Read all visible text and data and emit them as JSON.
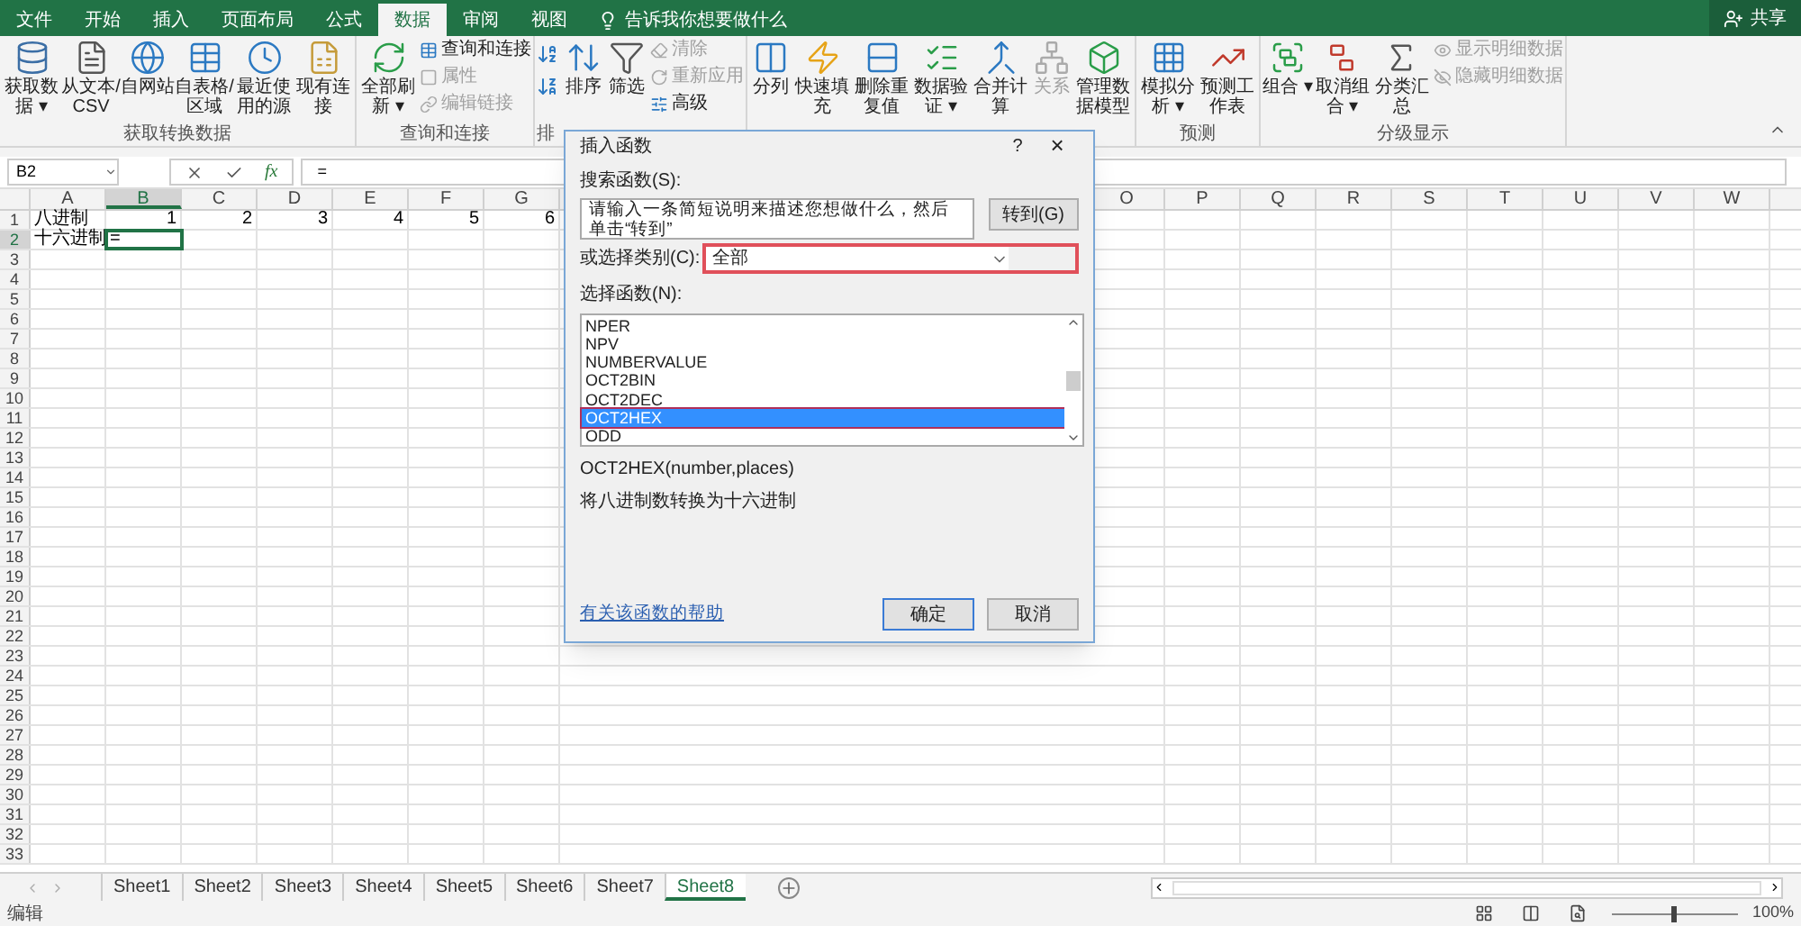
{
  "ribbon_tabs": [
    {
      "label": "文件",
      "selected": false
    },
    {
      "label": "开始",
      "selected": false
    },
    {
      "label": "插入",
      "selected": false
    },
    {
      "label": "页面布局",
      "selected": false
    },
    {
      "label": "公式",
      "selected": false
    },
    {
      "label": "数据",
      "selected": true
    },
    {
      "label": "审阅",
      "selected": false
    },
    {
      "label": "视图",
      "selected": false
    }
  ],
  "tell_me": "告诉我你想要做什么",
  "share": "共享",
  "ribbon_groups": [
    {
      "label": "获取转换数据",
      "items": [
        {
          "kind": "large",
          "label": "获取数据 ▾",
          "disabled": false
        },
        {
          "kind": "large",
          "label": "从文本/CSV",
          "disabled": false
        },
        {
          "kind": "large",
          "label": "自网站",
          "disabled": false
        },
        {
          "kind": "large",
          "label": "自表格/区域",
          "disabled": false
        },
        {
          "kind": "large",
          "label": "最近使用的源",
          "disabled": false
        },
        {
          "kind": "large",
          "label": "现有连接",
          "disabled": false
        }
      ]
    },
    {
      "label": "查询和连接",
      "items": [
        {
          "kind": "large",
          "label": "全部刷新 ▾",
          "disabled": false
        },
        {
          "kind": "small",
          "label": "查询和连接",
          "disabled": false
        },
        {
          "kind": "small",
          "label": "属性",
          "disabled": true
        },
        {
          "kind": "small",
          "label": "编辑链接",
          "disabled": true
        }
      ]
    },
    {
      "label": "排",
      "items": [
        {
          "kind": "sort"
        },
        {
          "kind": "large",
          "label": "排序",
          "disabled": false
        },
        {
          "kind": "large",
          "label": "筛选",
          "disabled": false
        },
        {
          "kind": "small",
          "label": "清除",
          "disabled": true
        },
        {
          "kind": "small",
          "label": "重新应用",
          "disabled": true
        },
        {
          "kind": "small",
          "label": "高级",
          "disabled": false
        }
      ]
    },
    {
      "items": [
        {
          "kind": "large",
          "label": "分列",
          "disabled": false
        },
        {
          "kind": "large",
          "label": "快速填充",
          "disabled": false
        },
        {
          "kind": "large",
          "label": "删除重复值",
          "disabled": false
        },
        {
          "kind": "large",
          "label": "数据验证 ▾",
          "disabled": false
        },
        {
          "kind": "large",
          "label": "合并计算",
          "disabled": false
        },
        {
          "kind": "large",
          "label": "关系",
          "disabled": true
        },
        {
          "kind": "large",
          "label": "管理数据模型",
          "disabled": false
        }
      ]
    },
    {
      "label": "预测",
      "items": [
        {
          "kind": "large",
          "label": "模拟分析 ▾",
          "disabled": false
        },
        {
          "kind": "large",
          "label": "预测工作表",
          "disabled": false
        }
      ]
    },
    {
      "label": "分级显示",
      "items": [
        {
          "kind": "large",
          "label": "组合 ▾",
          "disabled": false
        },
        {
          "kind": "large",
          "label": "取消组合 ▾",
          "disabled": false
        },
        {
          "kind": "large",
          "label": "分类汇总",
          "disabled": false
        },
        {
          "kind": "small",
          "label": "显示明细数据",
          "disabled": true
        },
        {
          "kind": "small",
          "label": "隐藏明细数据",
          "disabled": true
        }
      ]
    }
  ],
  "formula_bar": {
    "name_box": "B2",
    "fx": "fx",
    "formula": "="
  },
  "grid": {
    "columns_left": [
      "A",
      "B",
      "C",
      "D",
      "E",
      "F",
      "G"
    ],
    "columns_right": [
      "O",
      "P",
      "Q",
      "R",
      "S",
      "T",
      "U",
      "V",
      "W"
    ],
    "rows": [
      {
        "number": "1",
        "cells": [
          {
            "kind": "text",
            "text": "八进制",
            "selected": false
          },
          {
            "kind": "number",
            "text": "1",
            "selected": false
          },
          {
            "kind": "number",
            "text": "2",
            "selected": false
          },
          {
            "kind": "number",
            "text": "3",
            "selected": false
          },
          {
            "kind": "number",
            "text": "4",
            "selected": false
          },
          {
            "kind": "number",
            "text": "5",
            "selected": false
          },
          {
            "kind": "number",
            "text": "6",
            "selected": false
          }
        ]
      },
      {
        "number": "2",
        "cells": [
          {
            "kind": "text",
            "text": "十六进制",
            "selected": false
          },
          {
            "kind": "text",
            "text": "=",
            "selected": true
          }
        ]
      },
      {
        "number": "3"
      },
      {
        "number": "4"
      },
      {
        "number": "5"
      },
      {
        "number": "6"
      },
      {
        "number": "7"
      },
      {
        "number": "8"
      },
      {
        "number": "9"
      },
      {
        "number": "10"
      },
      {
        "number": "11"
      },
      {
        "number": "12"
      },
      {
        "number": "13"
      },
      {
        "number": "14"
      },
      {
        "number": "15"
      },
      {
        "number": "16"
      },
      {
        "number": "17"
      },
      {
        "number": "18"
      },
      {
        "number": "19"
      },
      {
        "number": "20"
      },
      {
        "number": "21"
      },
      {
        "number": "22"
      },
      {
        "number": "23"
      },
      {
        "number": "24"
      },
      {
        "number": "25"
      },
      {
        "number": "26"
      },
      {
        "number": "27"
      },
      {
        "number": "28"
      },
      {
        "number": "29"
      },
      {
        "number": "30"
      },
      {
        "number": "31"
      },
      {
        "number": "32"
      },
      {
        "number": "33"
      }
    ]
  },
  "sheets": [
    {
      "label": "Sheet1",
      "selected": false
    },
    {
      "label": "Sheet2",
      "selected": false
    },
    {
      "label": "Sheet3",
      "selected": false
    },
    {
      "label": "Sheet4",
      "selected": false
    },
    {
      "label": "Sheet5",
      "selected": false
    },
    {
      "label": "Sheet6",
      "selected": false
    },
    {
      "label": "Sheet7",
      "selected": false
    },
    {
      "label": "Sheet8",
      "selected": true
    }
  ],
  "status_bar": {
    "mode": "编辑",
    "zoom": "100%",
    "zoom_slider": {
      "level": 0.5
    }
  },
  "dialog": {
    "title": "插入函数",
    "help": "?",
    "close": "×",
    "search_label": "搜索函数(S):",
    "search_value": "请输入一条简短说明来描述您想做什么，然后单击“转到”",
    "go_button": "转到(G)",
    "category_label": "或选择类别(C):",
    "category_value": "全部",
    "list_label": "选择函数(N):",
    "functions": [
      {
        "label": "NPER",
        "selected": false
      },
      {
        "label": "NPV",
        "selected": false
      },
      {
        "label": "NUMBERVALUE",
        "selected": false
      },
      {
        "label": "OCT2BIN",
        "selected": false
      },
      {
        "label": "OCT2DEC",
        "selected": false
      },
      {
        "label": "OCT2HEX",
        "selected": true
      },
      {
        "label": "ODD",
        "selected": false
      }
    ],
    "signature": "OCT2HEX(number,places)",
    "description": "将八进制数转换为十六进制",
    "help_link": "有关该函数的帮助",
    "ok": "确定",
    "cancel": "取消"
  }
}
